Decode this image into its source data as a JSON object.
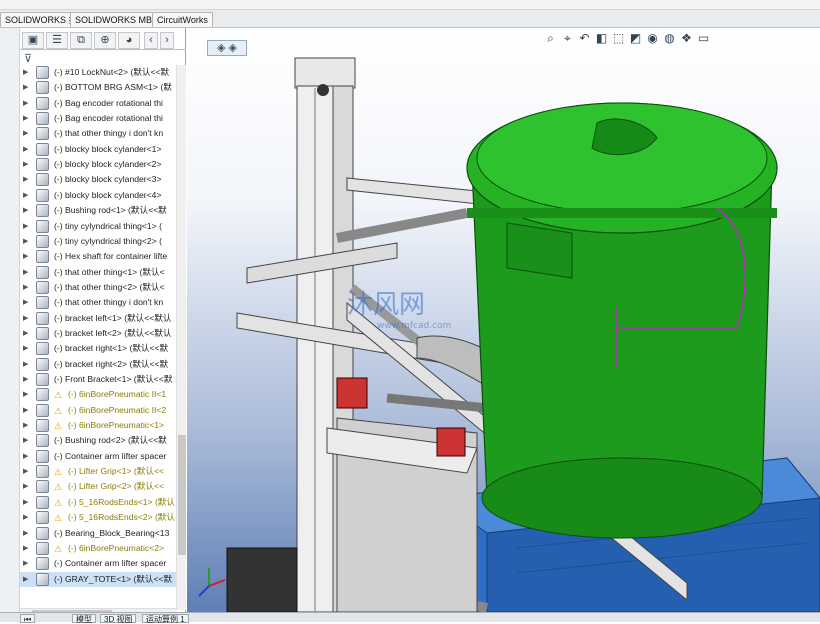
{
  "tabs": [
    "SOLIDWORKS 插件",
    "SOLIDWORKS MBD",
    "CircuitWorks"
  ],
  "panel": {
    "filter_icon": "filter-icon",
    "tree": [
      {
        "label": "(-) #10 LockNut<2> (默认<<默",
        "warn": false
      },
      {
        "label": "(-) BOTTOM BRG ASM<1> (默",
        "warn": false
      },
      {
        "label": "(-) Bag encoder rotational thi",
        "warn": false
      },
      {
        "label": "(-) Bag encoder rotational thi",
        "warn": false
      },
      {
        "label": "(-) that other thingy i don't kn",
        "warn": false
      },
      {
        "label": "(-) blocky block cylander<1>",
        "warn": false
      },
      {
        "label": "(-) blocky block cylander<2>",
        "warn": false
      },
      {
        "label": "(-) blocky block cylander<3>",
        "warn": false
      },
      {
        "label": "(-) blocky block cylander<4>",
        "warn": false
      },
      {
        "label": "(-) Bushing rod<1> (默认<<默",
        "warn": false
      },
      {
        "label": "(-) tiny cylyndrical thing<1> (",
        "warn": false
      },
      {
        "label": "(-) tiny cylyndrical thing<2> (",
        "warn": false
      },
      {
        "label": "(-) Hex shaft for container lifte",
        "warn": false
      },
      {
        "label": "(-) that other thing<1> (默认<",
        "warn": false
      },
      {
        "label": "(-) that other thing<2> (默认<",
        "warn": false
      },
      {
        "label": "(-) that other thingy i don't kn",
        "warn": false
      },
      {
        "label": "(-) bracket left<1> (默认<<默认",
        "warn": false
      },
      {
        "label": "(-) bracket left<2> (默认<<默认",
        "warn": false
      },
      {
        "label": "(-) bracket right<1> (默认<<默",
        "warn": false
      },
      {
        "label": "(-) bracket right<2> (默认<<默",
        "warn": false
      },
      {
        "label": "(-) Front Bracket<1> (默认<<默",
        "warn": false
      },
      {
        "label": "(-) 6inBorePneumatic II<1",
        "warn": true
      },
      {
        "label": "(-) 6inBorePneumatic II<2",
        "warn": true
      },
      {
        "label": "(-) 6inBorePneumatic<1>",
        "warn": true
      },
      {
        "label": "(-) Bushing rod<2> (默认<<默",
        "warn": false
      },
      {
        "label": "(-) Container arm lifter spacer",
        "warn": false
      },
      {
        "label": "(-) Lifter Grip<1> (默认<<",
        "warn": true
      },
      {
        "label": "(-) Lifter Grip<2> (默认<<",
        "warn": true
      },
      {
        "label": "(-) 5_16RodsEnds<1> (默认",
        "warn": true
      },
      {
        "label": "(-) 5_16RodsEnds<2> (默认",
        "warn": true
      },
      {
        "label": "(-) Bearing_Block_Bearing<13",
        "warn": false
      },
      {
        "label": "(-) 6inBorePneumatic<2>",
        "warn": true
      },
      {
        "label": "(-) Container arm lifter spacer",
        "warn": false
      },
      {
        "label": "(-) GRAY_TOTE<1> (默认<<默",
        "warn": false
      }
    ]
  },
  "bottom_tabs": [
    "模型",
    "3D 视图",
    "运动算例 1"
  ],
  "watermark": {
    "main": "沐风网",
    "sub": "www.mfcad.com"
  },
  "viewport_tools": [
    "zoom-fit-icon",
    "zoom-area-icon",
    "previous-view-icon",
    "section-view-icon",
    "view-orientation-icon",
    "display-style-icon",
    "hide-show-icon",
    "edit-appearance-icon",
    "apply-scene-icon",
    "monitor-icon"
  ]
}
